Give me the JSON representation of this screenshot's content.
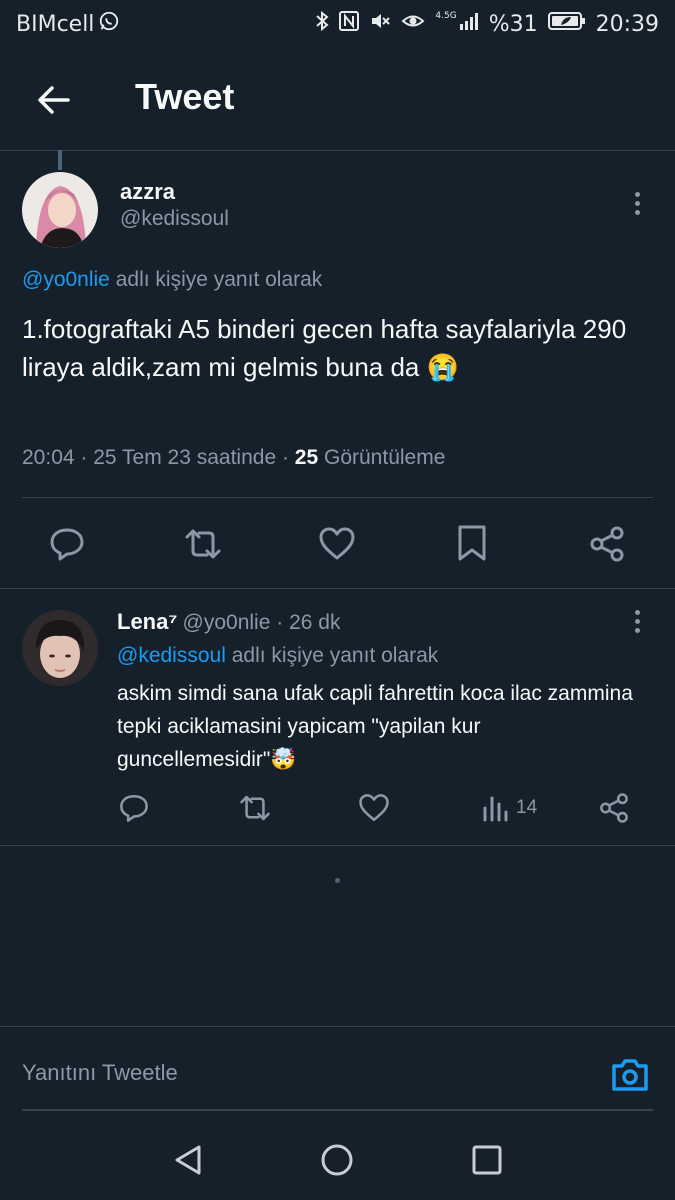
{
  "status_bar": {
    "carrier": "BIMcell",
    "network": "4.5G",
    "battery": "%31",
    "time": "20:39"
  },
  "header": {
    "title": "Tweet"
  },
  "tweet": {
    "author_name": "azzra",
    "author_handle": "@kedissoul",
    "reply_to_handle": "@yo0nlie",
    "reply_to_suffix": " adlı kişiye yanıt olarak",
    "text": "1.fotograftaki A5 binderi gecen hafta sayfalariyla 290 liraya aldik,zam mi gelmis buna da 😭",
    "time": "20:04 · 25 Tem 23 saatinde · ",
    "views_count": "25",
    "views_label": " Görüntüleme"
  },
  "reply": {
    "author_name": "Lena⁷",
    "author_handle": "@yo0nlie",
    "time_ago": " · 26 dk",
    "reply_to_handle": "@kedissoul",
    "reply_to_suffix": " adlı kişiye yanıt olarak",
    "text": "askim simdi sana ufak capli fahrettin koca ilac zammina tepki aciklamasini yapicam \"yapilan kur guncellemesidir\"🤯",
    "views_count": "14"
  },
  "composer": {
    "placeholder": "Yanıtını Tweetle"
  },
  "colors": {
    "background": "#15202b",
    "accent": "#1d9bf0",
    "muted": "#8b98a5",
    "divider": "#38444d"
  }
}
